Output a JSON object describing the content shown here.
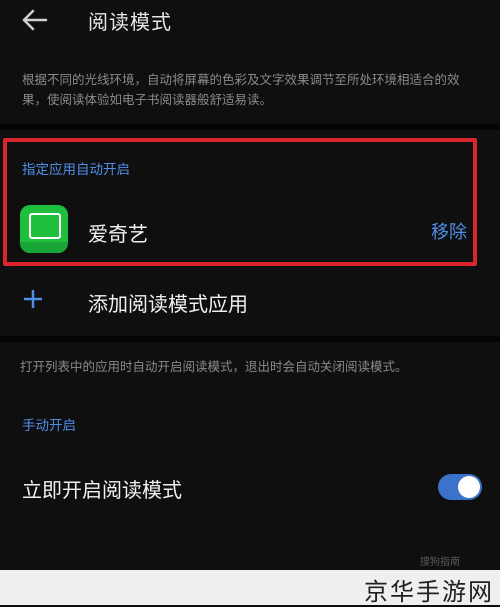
{
  "header": {
    "title": "阅读模式"
  },
  "description": "根据不同的光线环境，自动将屏幕的色彩及文字效果调节至所处环境相适合的效果，使阅读体验如电子书阅读器般舒适易读。",
  "auto_section": {
    "title": "指定应用自动开启",
    "apps": [
      {
        "name": "爱奇艺",
        "icon": "iqiyi-app-icon",
        "action_label": "移除"
      }
    ],
    "add_label": "添加阅读模式应用"
  },
  "note": "打开列表中的应用时自动开启阅读模式，退出时会自动关闭阅读模式。",
  "manual_section": {
    "title": "手动开启",
    "toggle_label": "立即开启阅读模式",
    "toggle_on": true
  },
  "watermark": {
    "small": "搜狗指南",
    "bar": "京华手游网"
  },
  "colors": {
    "accent": "#4f8ee8",
    "highlight_border": "#d9262e",
    "toggle_on": "#3a73c9"
  }
}
